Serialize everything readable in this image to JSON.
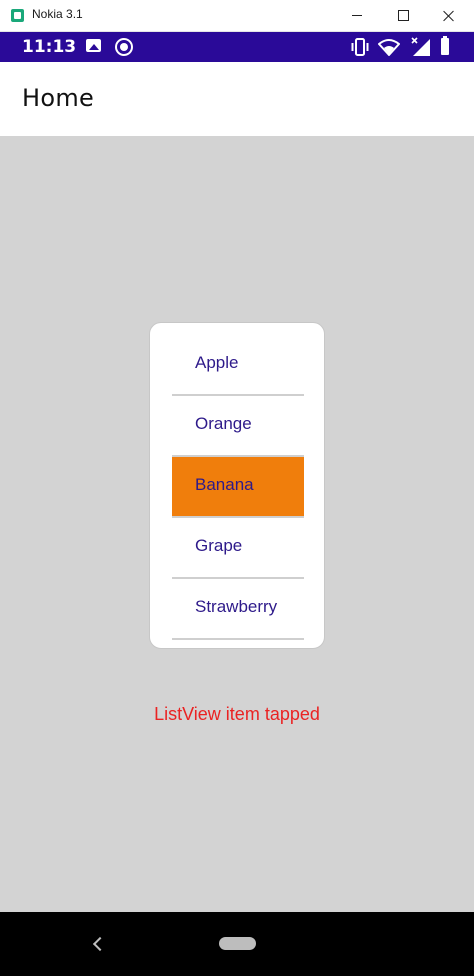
{
  "window": {
    "title": "Nokia 3.1"
  },
  "status_bar": {
    "time": "11:13",
    "icons": [
      "image-icon",
      "sync-icon",
      "vibrate-icon",
      "wifi-icon",
      "signal-icon",
      "battery-icon"
    ]
  },
  "app_bar": {
    "title": "Home"
  },
  "list": {
    "items": [
      {
        "label": "Apple"
      },
      {
        "label": "Orange"
      },
      {
        "label": "Banana"
      },
      {
        "label": "Grape"
      },
      {
        "label": "Strawberry"
      }
    ],
    "selected_index": 2,
    "selected_color": "#f07e0c",
    "item_text_color": "#2e1a8a"
  },
  "message": {
    "text": "ListView item tapped",
    "color": "#ea2323"
  },
  "nav_bar": {
    "buttons": [
      "back-icon",
      "home-pill"
    ]
  }
}
